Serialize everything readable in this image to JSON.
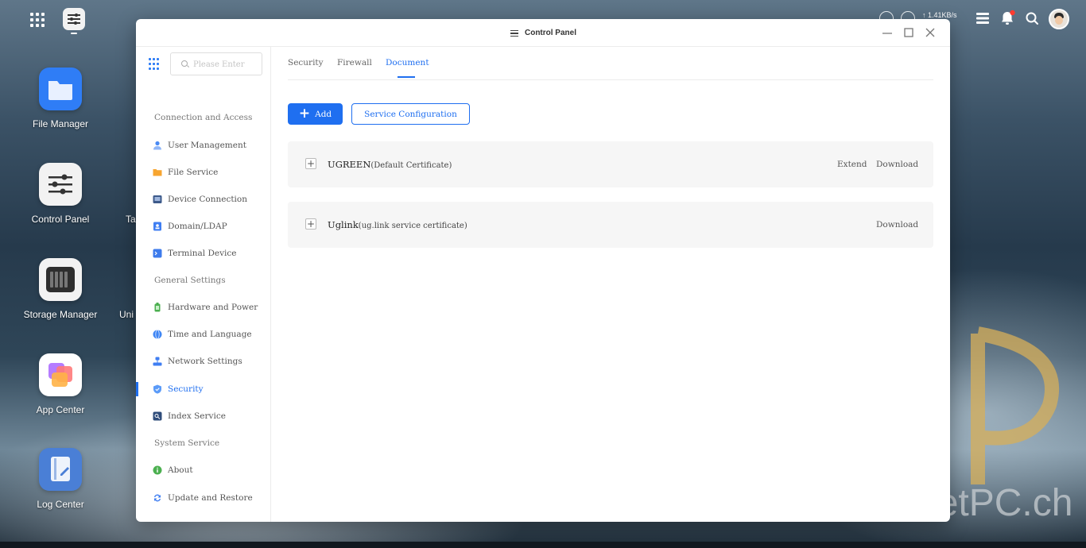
{
  "topbar": {
    "network_speed": "↑ 1.41KB/s"
  },
  "desktop": {
    "icons": [
      {
        "label": "File Manager",
        "icon": "folder-icon",
        "color": "#2f7df6"
      },
      {
        "label": "Control Panel",
        "icon": "sliders-icon",
        "color": "#f2f2f2"
      },
      {
        "label": "Storage Manager",
        "icon": "drives-icon",
        "color": "#f2f2f2"
      },
      {
        "label": "App Center",
        "icon": "app-center-icon",
        "color": "#ffffff"
      },
      {
        "label": "Log Center",
        "icon": "log-icon",
        "color": "#4a7fd6"
      }
    ],
    "partial_labels": [
      "Ta",
      "Uni"
    ]
  },
  "window": {
    "title": "Control Panel",
    "search_placeholder": "Please Enter",
    "sidebar": {
      "sections": [
        {
          "heading": "Connection and Access",
          "items": [
            {
              "label": "User Management",
              "icon": "user-icon"
            },
            {
              "label": "File Service",
              "icon": "folder-icon"
            },
            {
              "label": "Device Connection",
              "icon": "device-icon"
            },
            {
              "label": "Domain/LDAP",
              "icon": "domain-icon"
            },
            {
              "label": "Terminal Device",
              "icon": "terminal-icon"
            }
          ]
        },
        {
          "heading": "General Settings",
          "items": [
            {
              "label": "Hardware and Power",
              "icon": "battery-icon"
            },
            {
              "label": "Time and Language",
              "icon": "globe-icon"
            },
            {
              "label": "Network Settings",
              "icon": "network-icon"
            },
            {
              "label": "Security",
              "icon": "shield-icon",
              "active": true
            },
            {
              "label": "Index Service",
              "icon": "index-icon"
            }
          ]
        },
        {
          "heading": "System Service",
          "items": [
            {
              "label": "About",
              "icon": "info-icon"
            },
            {
              "label": "Update and Restore",
              "icon": "refresh-icon"
            }
          ]
        }
      ]
    },
    "tabs": [
      {
        "label": "Security"
      },
      {
        "label": "Firewall"
      },
      {
        "label": "Document",
        "active": true
      }
    ],
    "buttons": {
      "add": "Add",
      "service_config": "Service Configuration"
    },
    "certificates": [
      {
        "name": "UGREEN",
        "note": "(Default Certificate)",
        "actions": [
          "Extend",
          "Download"
        ]
      },
      {
        "name": "Uglink",
        "note": "(ug.link service certificate)",
        "actions": [
          "Download"
        ]
      }
    ]
  },
  "watermark": {
    "text": "PocketPC.ch"
  },
  "colors": {
    "accent": "#1f6ff0",
    "row_bg": "#f6f6f6"
  }
}
